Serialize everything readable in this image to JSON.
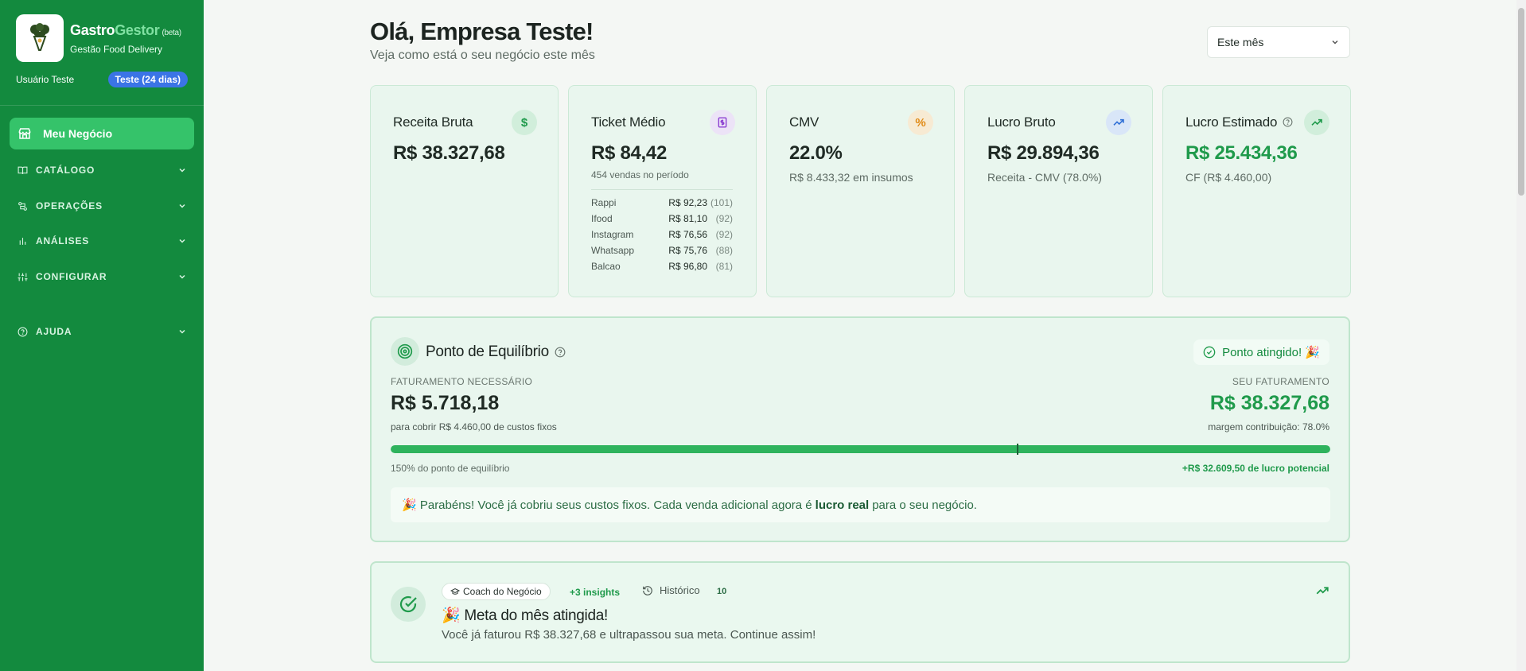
{
  "sidebar": {
    "brand_part1": "Gastro",
    "brand_part2": "Gestor",
    "beta": "(beta)",
    "subtitle": "Gestão Food Delivery",
    "user": "Usuário Teste",
    "trial_badge": "Teste (24 dias)",
    "active_item": "Meu Negócio",
    "items": [
      {
        "label": "CATÁLOGO",
        "icon": "book-icon"
      },
      {
        "label": "OPERAÇÕES",
        "icon": "workflow-icon"
      },
      {
        "label": "ANÁLISES",
        "icon": "bar-chart-icon"
      },
      {
        "label": "CONFIGURAR",
        "icon": "sliders-icon"
      },
      {
        "label": "AJUDA",
        "icon": "help-circle-icon"
      }
    ]
  },
  "header": {
    "greeting": "Olá, Empresa Teste!",
    "subtitle": "Veja como está o seu negócio este mês",
    "period": "Este mês"
  },
  "cards": {
    "receita": {
      "title": "Receita Bruta",
      "value": "R$ 38.327,68",
      "icon": "dollar-icon"
    },
    "ticket": {
      "title": "Ticket Médio",
      "value": "R$ 84,42",
      "note": "454 vendas no período",
      "icon": "receipt-icon",
      "channels": [
        {
          "name": "Rappi",
          "value": "R$ 92,23",
          "count": "(101)"
        },
        {
          "name": "Ifood",
          "value": "R$ 81,10",
          "count": "(92)"
        },
        {
          "name": "Instagram",
          "value": "R$ 76,56",
          "count": "(92)"
        },
        {
          "name": "Whatsapp",
          "value": "R$ 75,76",
          "count": "(88)"
        },
        {
          "name": "Balcao",
          "value": "R$ 96,80",
          "count": "(81)"
        }
      ]
    },
    "cmv": {
      "title": "CMV",
      "value": "22.0%",
      "note": "R$ 8.433,32 em insumos",
      "icon": "percent-icon"
    },
    "lucro_bruto": {
      "title": "Lucro Bruto",
      "value": "R$ 29.894,36",
      "note": "Receita - CMV (78.0%)",
      "icon": "trending-up-icon"
    },
    "lucro_estimado": {
      "title": "Lucro Estimado",
      "value": "R$ 25.434,36",
      "note": "CF (R$ 4.460,00)",
      "icon": "trending-up-icon"
    }
  },
  "breakeven": {
    "title": "Ponto de Equilíbrio",
    "badge": "Ponto atingido! 🎉",
    "left_label": "FATURAMENTO NECESSÁRIO",
    "left_value": "R$ 5.718,18",
    "left_note": "para cobrir R$ 4.460,00 de custos fixos",
    "right_label": "SEU FATURAMENTO",
    "right_value": "R$ 38.327,68",
    "right_note": "margem contribuição: 78.0%",
    "progress_fill": 1.0,
    "foot_left": "150% do ponto de equilíbrio",
    "foot_right": "+R$ 32.609,50 de lucro potencial",
    "msg_before": "🎉 Parabéns! Você já cobriu seus custos fixos. Cada venda adicional agora é",
    "msg_bold": "lucro real",
    "msg_after": "para o seu negócio."
  },
  "coach": {
    "chip": "Coach do Negócio",
    "more": "+3 insights",
    "history": "Histórico",
    "history_count": "10",
    "title": "🎉 Meta do mês atingida!",
    "text": "Você já faturou R$ 38.327,68 e ultrapassou sua meta. Continue assim!"
  },
  "colors": {
    "sidebar": "#138a3e",
    "accent": "#35c36a",
    "profit": "#1f9a4b",
    "trial": "#3b74e6"
  }
}
